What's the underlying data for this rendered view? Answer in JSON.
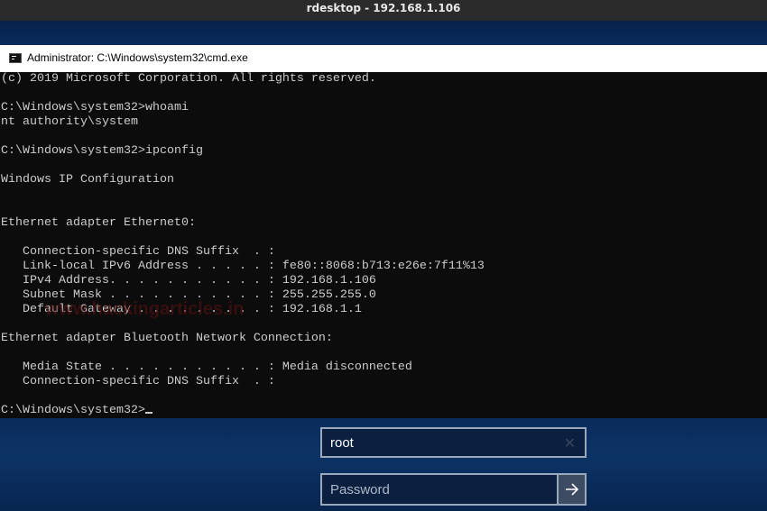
{
  "rdesktop": {
    "title": "rdesktop - 192.168.1.106"
  },
  "cmd": {
    "title": "Administrator: C:\\Windows\\system32\\cmd.exe",
    "lines": [
      "(c) 2019 Microsoft Corporation. All rights reserved.",
      "",
      "C:\\Windows\\system32>whoami",
      "nt authority\\system",
      "",
      "C:\\Windows\\system32>ipconfig",
      "",
      "Windows IP Configuration",
      "",
      "",
      "Ethernet adapter Ethernet0:",
      "",
      "   Connection-specific DNS Suffix  . :",
      "   Link-local IPv6 Address . . . . . : fe80::8068:b713:e26e:7f11%13",
      "   IPv4 Address. . . . . . . . . . . : 192.168.1.106",
      "   Subnet Mask . . . . . . . . . . . : 255.255.255.0",
      "   Default Gateway . . . . . . . . . : 192.168.1.1",
      "",
      "Ethernet adapter Bluetooth Network Connection:",
      "",
      "   Media State . . . . . . . . . . . : Media disconnected",
      "   Connection-specific DNS Suffix  . :",
      ""
    ],
    "prompt": "C:\\Windows\\system32>"
  },
  "watermark": "www.hackingarticles.in",
  "login": {
    "username_value": "root",
    "password_placeholder": "Password"
  },
  "icons": {
    "clear": "close-icon",
    "submit": "arrow-right-icon",
    "cmd": "cmd-icon"
  }
}
